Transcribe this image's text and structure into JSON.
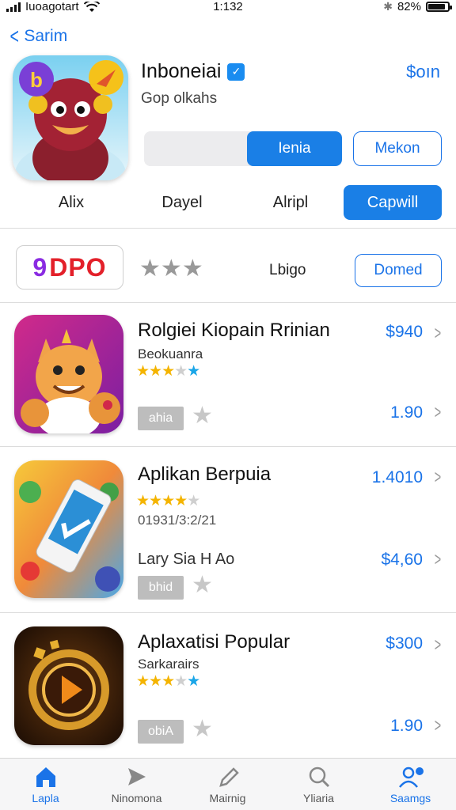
{
  "status_bar": {
    "carrier": "Iuoagotart",
    "time": "1:132",
    "battery": "82%"
  },
  "nav": {
    "back_label": "Sarim"
  },
  "app": {
    "title": "Inboneiai",
    "subtitle": "Gop olkahs",
    "price": "$oın",
    "segment_label": "Ienia",
    "secondary_button": "Mekon"
  },
  "tabs": [
    {
      "label": "Alix"
    },
    {
      "label": "Dayel"
    },
    {
      "label": "Alripl"
    },
    {
      "label": "Capwill"
    }
  ],
  "promo": {
    "logo_text": "DPO",
    "logo_mark": "9",
    "label": "Lbigo",
    "button": "Domed",
    "stars_text": "dpo"
  },
  "items": [
    {
      "name": "Rolgiei Kiopain Rrinian",
      "subtitle": "Beokuanra",
      "rating": 3.5,
      "price": "$940",
      "badge": "ahia",
      "secondary_price": "1.90"
    },
    {
      "name": "Aplikan Berpuia",
      "subtitle": "01931/3:2/21",
      "rating": 3.5,
      "price": "1.4010",
      "extra_line": "Lary Sia H Ao",
      "badge": "bhid",
      "secondary_price": "$4,60"
    },
    {
      "name": "Aplaxatisi Popular",
      "subtitle": "Sarkarairs",
      "rating": 3.5,
      "price": "$300",
      "badge": "obiA",
      "secondary_price": "1.90"
    }
  ],
  "tabbar": [
    {
      "label": "Lapla",
      "icon": "home-icon",
      "active": true
    },
    {
      "label": "Ninomona",
      "icon": "send-icon",
      "active": false
    },
    {
      "label": "Mairnig",
      "icon": "pencil-icon",
      "active": false
    },
    {
      "label": "Yliaria",
      "icon": "search-icon",
      "active": false
    },
    {
      "label": "Saamgs",
      "icon": "account-icon",
      "active": true
    }
  ],
  "colors": {
    "accent": "#1a7fe6",
    "star": "#f4b400",
    "star_blue": "#1aa6e8"
  }
}
